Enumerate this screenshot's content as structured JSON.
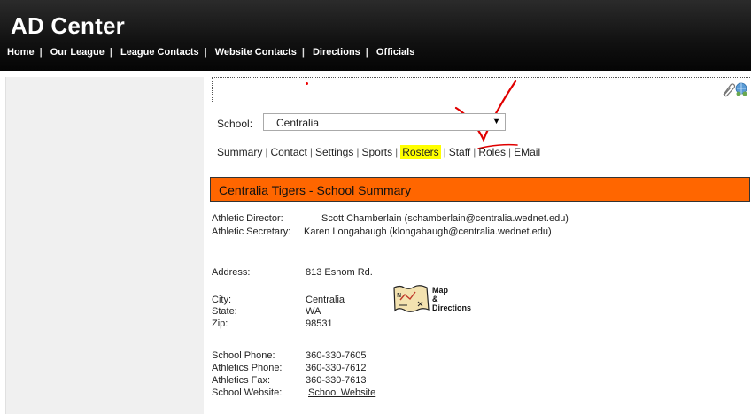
{
  "app": {
    "title": "AD Center"
  },
  "topnav": {
    "items": [
      "Home",
      "Our League",
      "League Contacts",
      "Website Contacts",
      "Directions",
      "Officials"
    ]
  },
  "school": {
    "label": "School:",
    "selected": "Centralia"
  },
  "subnav": {
    "items": [
      "Summary",
      "Contact",
      "Settings",
      "Sports",
      "Rosters",
      "Staff",
      "Roles",
      "EMail"
    ],
    "highlighted": "Rosters"
  },
  "summary": {
    "title": "Centralia Tigers - School Summary",
    "athletic_director_label": "Athletic Director:",
    "athletic_director_value": "Scott Chamberlain (schamberlain@centralia.wednet.edu)",
    "athletic_secretary_label": "Athletic Secretary:",
    "athletic_secretary_value": "Karen Longabaugh (klongabaugh@centralia.wednet.edu)",
    "address_label": "Address:",
    "address_value": "813 Eshom Rd.",
    "city_label": "City:",
    "city_value": "Centralia",
    "state_label": "State:",
    "state_value": "WA",
    "zip_label": "Zip:",
    "zip_value": "98531",
    "map_label_1": "Map",
    "map_label_2": "&",
    "map_label_3": "Directions",
    "school_phone_label": "School Phone:",
    "school_phone_value": "360-330-7605",
    "athletics_phone_label": "Athletics Phone:",
    "athletics_phone_value": "360-330-7612",
    "athletics_fax_label": "Athletics Fax:",
    "athletics_fax_value": "360-330-7613",
    "school_website_label": "School Website:",
    "school_website_value": "School Website"
  },
  "colors": {
    "header_bg": "#111111",
    "summary_bar": "#ff6600",
    "highlight": "#ffff00",
    "annotation": "#e00000"
  },
  "icons": [
    "paperclip-icon",
    "globe-people-icon",
    "map-directions-icon",
    "dropdown-arrow-icon"
  ]
}
